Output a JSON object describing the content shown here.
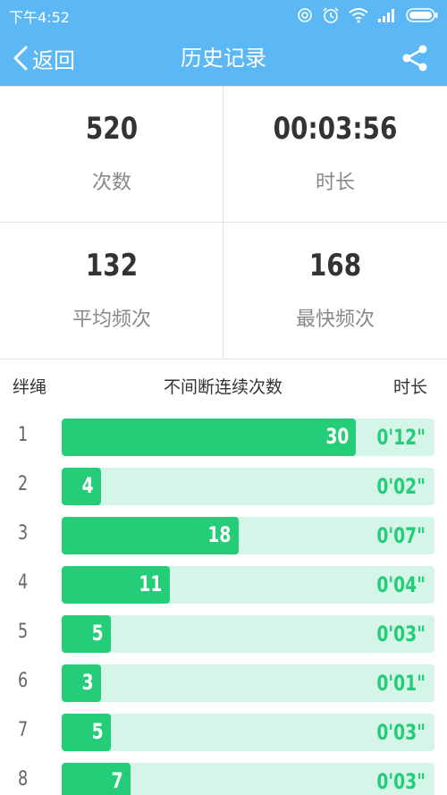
{
  "status_bar": {
    "time": "下午4:52"
  },
  "nav": {
    "back_label": "返回",
    "title": "历史记录"
  },
  "stats": [
    {
      "value": "520",
      "label": "次数"
    },
    {
      "value": "00:03:56",
      "label": "时长"
    },
    {
      "value": "132",
      "label": "平均频次"
    },
    {
      "value": "168",
      "label": "最快频次"
    }
  ],
  "table": {
    "headers": {
      "trip": "绊绳",
      "count": "不间断连续次数",
      "duration": "时长"
    },
    "max_count": 38,
    "rows": [
      {
        "index": "1",
        "count": "30",
        "duration": "0'12\""
      },
      {
        "index": "2",
        "count": "4",
        "duration": "0'02\""
      },
      {
        "index": "3",
        "count": "18",
        "duration": "0'07\""
      },
      {
        "index": "4",
        "count": "11",
        "duration": "0'04\""
      },
      {
        "index": "5",
        "count": "5",
        "duration": "0'03\""
      },
      {
        "index": "6",
        "count": "3",
        "duration": "0'01\""
      },
      {
        "index": "7",
        "count": "5",
        "duration": "0'03\""
      },
      {
        "index": "8",
        "count": "7",
        "duration": "0'03\""
      }
    ]
  },
  "colors": {
    "header_blue": "#5bb8f5",
    "bar_green": "#24cd77",
    "track_green": "#d6f5e9"
  }
}
